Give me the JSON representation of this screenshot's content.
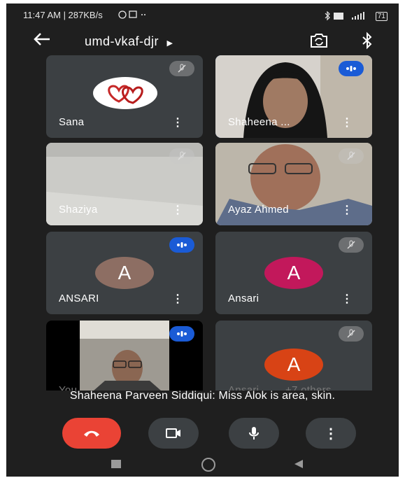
{
  "status_bar": {
    "time_speed": "11:47 AM | 287KB/s",
    "battery": "71"
  },
  "meeting": {
    "code": "umd-vkaf-djr"
  },
  "participants": [
    {
      "name": "Sana",
      "state": "muted"
    },
    {
      "name": "Shaheena ...",
      "state": "speaking"
    },
    {
      "name": "Shaziya",
      "state": "muted"
    },
    {
      "name": "Ayaz Ahmed",
      "state": "muted"
    },
    {
      "name": "ANSARI",
      "initial": "A",
      "avatar_color": "#8d6e63",
      "state": "speaking"
    },
    {
      "name": "Ansari",
      "initial": "A",
      "avatar_color": "#c2185b",
      "state": "muted"
    },
    {
      "name": "You",
      "state": "speaking"
    },
    {
      "name": "Ansari",
      "initial": "A",
      "avatar_color": "#d84315",
      "extra": "+7 others",
      "state": "muted"
    }
  ],
  "caption": "Shaheena Parveen Siddiqui: Miss Alok is area, skin.",
  "colors": {
    "end_call": "#ea4335",
    "control_bg": "#3c4043",
    "speaking": "#1a5bd6",
    "tile_bg": "#3c4043",
    "page_bg": "#1f1f1f"
  },
  "icons": [
    "back-arrow-icon",
    "switch-camera-icon",
    "bluetooth-icon",
    "mic-off-icon",
    "audio-level-icon",
    "end-call-icon",
    "camera-icon",
    "mic-icon",
    "more-vert-icon"
  ]
}
